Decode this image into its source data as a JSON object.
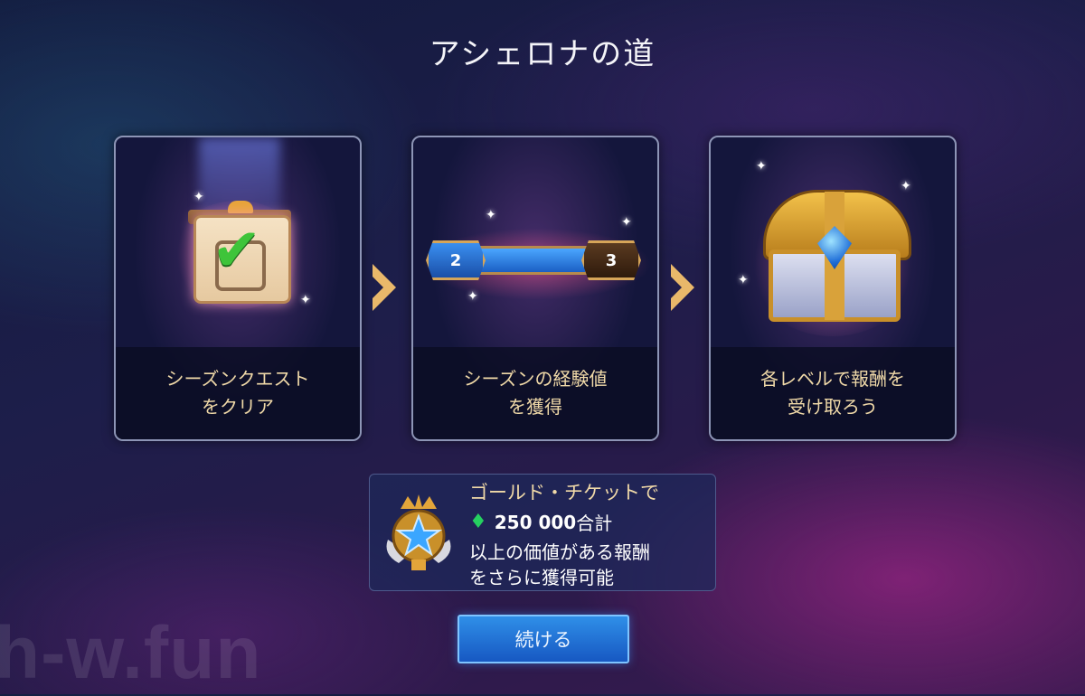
{
  "title": "アシェロナの道",
  "cards": [
    {
      "label_line1": "シーズンクエスト",
      "label_line2": "をクリア",
      "icon": "clipboard-check-icon"
    },
    {
      "label_line1": "シーズンの経験値",
      "label_line2": "を獲得",
      "icon": "level-progress-bar",
      "level_from": "2",
      "level_to": "3",
      "progress": 0.75
    },
    {
      "label_line1": "各レベルで報酬を",
      "label_line2": "受け取ろう",
      "icon": "treasure-chest-icon"
    }
  ],
  "info": {
    "line1": "ゴールド・チケットで",
    "amount": "250 000",
    "amount_suffix": "合計",
    "line3": "以上の価値がある報酬",
    "line4": "をさらに獲得可能",
    "icon": "star-medal-icon",
    "gem_icon": "green-gem-icon"
  },
  "continue_label": "続ける",
  "watermark": "h-w.fun",
  "colors": {
    "accent_gold": "#f0d9a8",
    "button_blue": "#1f72d8",
    "progress_blue": "#3a8ff0"
  }
}
